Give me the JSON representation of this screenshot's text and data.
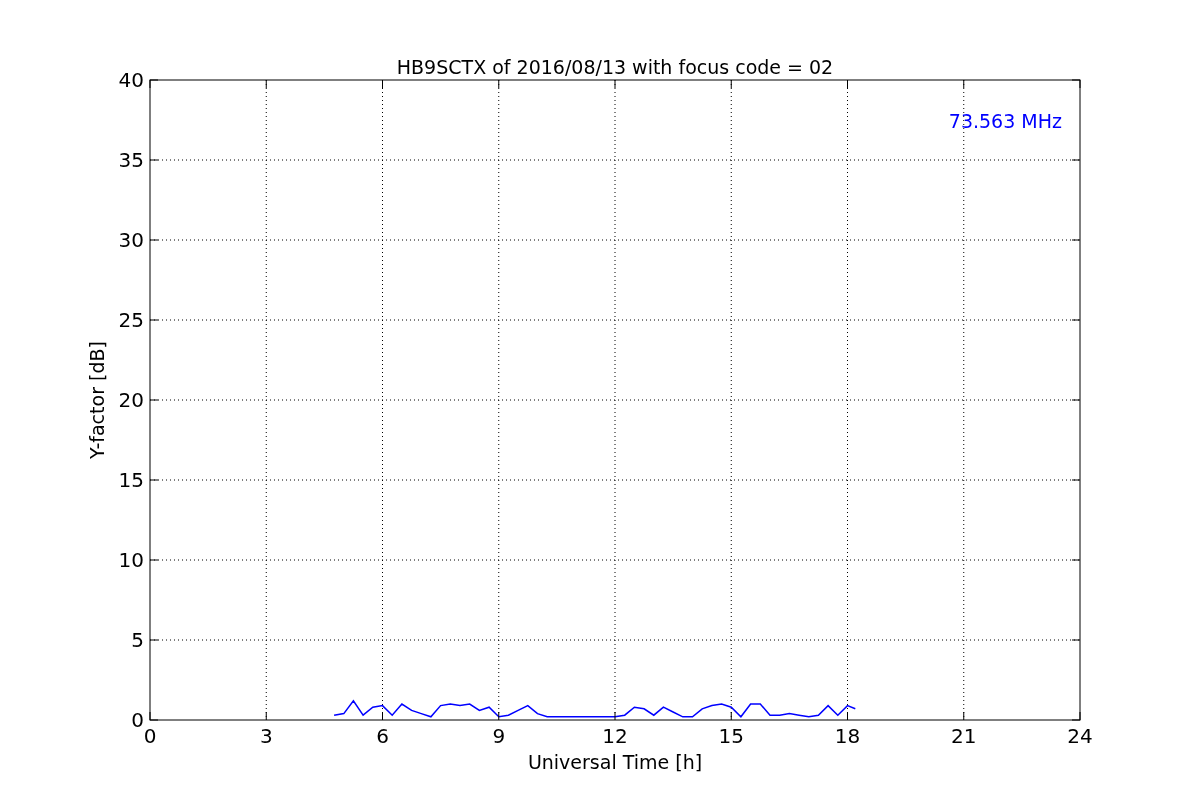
{
  "figure": {
    "chart_data": {
      "type": "line",
      "title": "HB9SCTX of 2016/08/13 with focus code = 02",
      "xlabel": "Universal Time [h]",
      "ylabel": "Y-factor [dB]",
      "x": [
        4.75,
        5,
        5.25,
        5.5,
        5.75,
        6,
        6.25,
        6.5,
        6.75,
        7,
        7.25,
        7.5,
        7.75,
        8,
        8.25,
        8.5,
        8.75,
        9,
        9.25,
        9.5,
        9.75,
        10,
        10.25,
        10.5,
        10.75,
        11,
        11.25,
        11.5,
        11.75,
        12,
        12.25,
        12.5,
        12.75,
        13,
        13.25,
        13.5,
        13.75,
        14,
        14.25,
        14.5,
        14.75,
        15,
        15.25,
        15.5,
        15.75,
        16,
        16.25,
        16.5,
        16.75,
        17,
        17.25,
        17.5,
        17.75,
        18,
        18.2
      ],
      "series": [
        {
          "color": "#0000ff",
          "values": [
            0.3,
            0.4,
            1.2,
            0.3,
            0.8,
            0.9,
            0.3,
            1.0,
            0.6,
            0.4,
            0.2,
            0.9,
            1.0,
            0.9,
            1.0,
            0.6,
            0.8,
            0.2,
            0.3,
            0.6,
            0.9,
            0.4,
            0.2,
            0.2,
            0.2,
            0.2,
            0.2,
            0.2,
            0.2,
            0.2,
            0.3,
            0.8,
            0.7,
            0.3,
            0.8,
            0.5,
            0.2,
            0.2,
            0.7,
            0.9,
            1.0,
            0.8,
            0.2,
            1.0,
            1.0,
            0.3,
            0.3,
            0.4,
            0.3,
            0.2,
            0.3,
            0.9,
            0.3,
            0.9,
            0.7
          ]
        }
      ],
      "grid": true,
      "xlim": [
        0,
        24
      ],
      "ylim": [
        0,
        40
      ],
      "xticks": [
        0,
        3,
        6,
        9,
        12,
        15,
        18,
        21,
        24
      ],
      "yticks": [
        0,
        5,
        10,
        15,
        20,
        25,
        30,
        35,
        40
      ],
      "annotations": [
        {
          "text": "73.563 MHz"
        }
      ]
    }
  }
}
